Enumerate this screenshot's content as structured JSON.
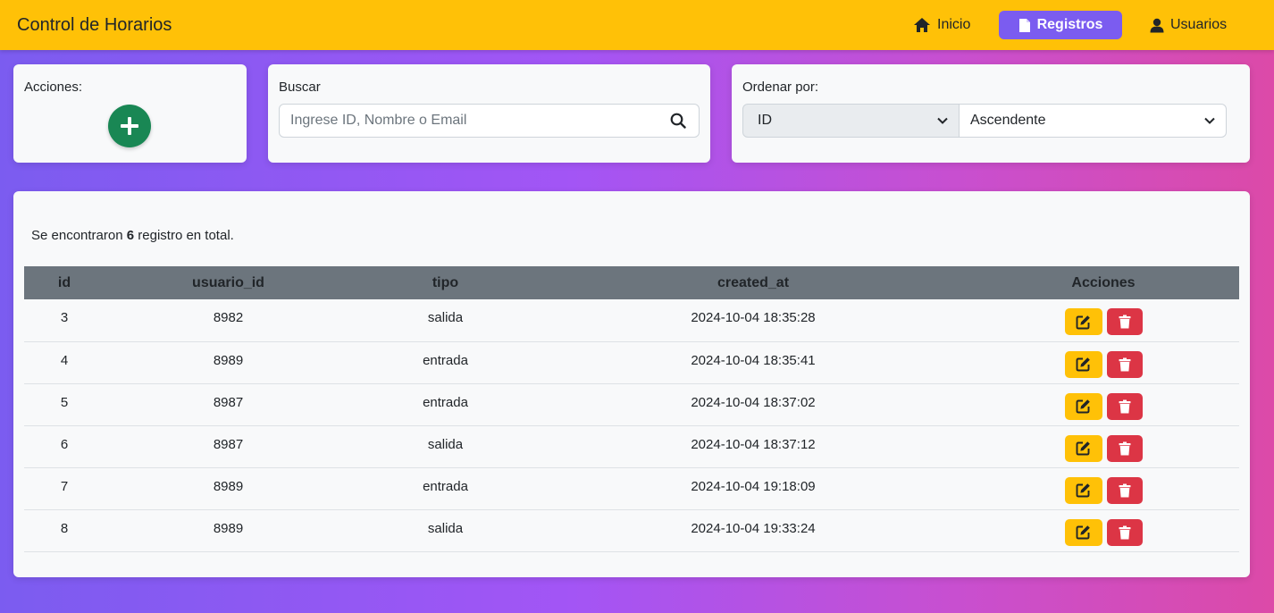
{
  "navbar": {
    "brand": "Control de Horarios",
    "links": [
      {
        "label": "Inicio",
        "icon": "home-icon",
        "active": false
      },
      {
        "label": "Registros",
        "icon": "file-icon",
        "active": true
      },
      {
        "label": "Usuarios",
        "icon": "user-icon",
        "active": false
      }
    ]
  },
  "actions": {
    "label": "Acciones:",
    "add_icon": "plus-icon"
  },
  "search": {
    "label": "Buscar",
    "placeholder": "Ingrese ID, Nombre o Email"
  },
  "order": {
    "label": "Ordenar por:",
    "field": "ID",
    "direction": "Ascendente"
  },
  "summary": {
    "prefix": "Se encontraron",
    "count": "6",
    "suffix": "registro en total."
  },
  "table": {
    "headers": [
      "id",
      "usuario_id",
      "tipo",
      "created_at",
      "Acciones"
    ],
    "rows": [
      [
        "3",
        "8982",
        "salida",
        "2024-10-04 18:35:28"
      ],
      [
        "4",
        "8989",
        "entrada",
        "2024-10-04 18:35:41"
      ],
      [
        "5",
        "8987",
        "entrada",
        "2024-10-04 18:37:02"
      ],
      [
        "6",
        "8987",
        "salida",
        "2024-10-04 18:37:12"
      ],
      [
        "7",
        "8989",
        "entrada",
        "2024-10-04 19:18:09"
      ],
      [
        "8",
        "8989",
        "salida",
        "2024-10-04 19:33:24"
      ]
    ]
  },
  "colors": {
    "navbar": "#ffc107",
    "active_tab": "#7b5cf0",
    "add": "#198754",
    "edit": "#ffc107",
    "delete": "#dc3545",
    "table_header": "#6c757d"
  }
}
